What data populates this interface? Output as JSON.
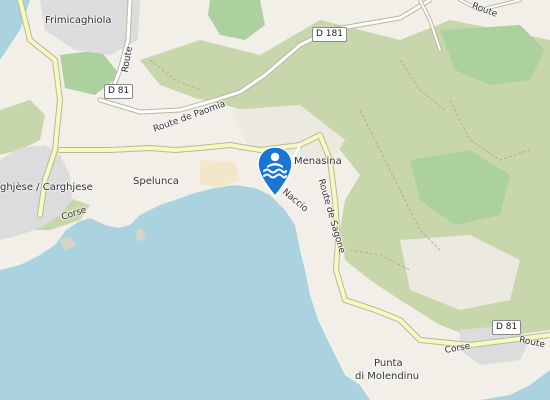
{
  "colors": {
    "sea": "#aad3df",
    "land": "#f2efe9",
    "scrub": "#c8d7ab",
    "wood": "#add19e",
    "residential": "#e0dfdf",
    "road_secondary": "#f7fabf",
    "road_casing": "#b8b8a0",
    "marker": "#1a76d2"
  },
  "labels": {
    "frimicaghiola": "Frimicaghiola",
    "cargese": "ghjèse / Carghjese",
    "spelunca": "Spelunca",
    "menasina": "Menasina",
    "punta_line1": "Punta",
    "punta_line2": "di Molendinu",
    "route_paomia": "Route de Paomia",
    "route_sagone": "Route de Sagone",
    "route_top": "Route",
    "route_top_right": "Route",
    "route_bottom_right": "Route",
    "corse_left": "Corse",
    "corse_right": "Corse",
    "peninsula_road": "Naccio"
  },
  "shields": {
    "d181": "D 181",
    "d81_left": "D 81",
    "d81_right": "D 81"
  },
  "marker": {
    "icon": "swimming-icon",
    "name": "beach-marker"
  }
}
